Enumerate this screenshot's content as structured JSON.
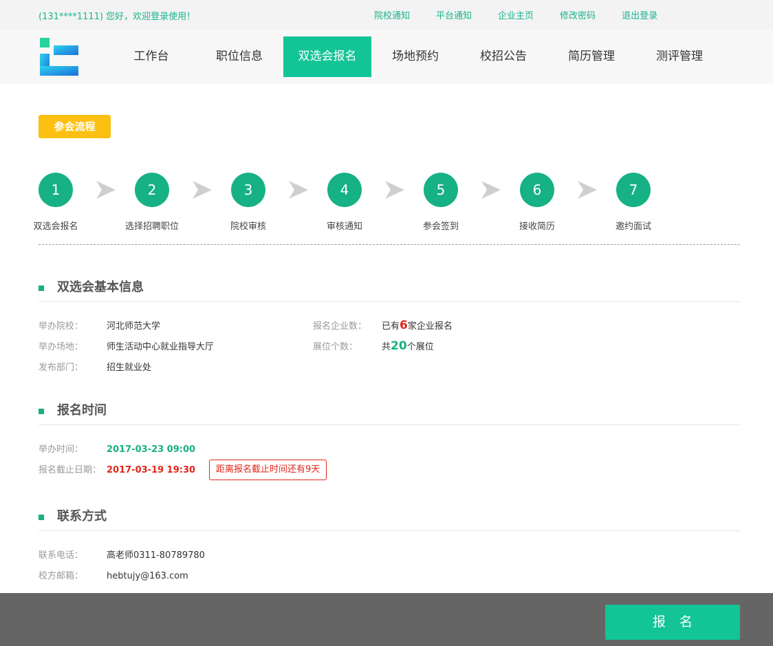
{
  "topbar": {
    "welcome": "(131****1111) 您好，欢迎登录使用！",
    "links": [
      "院校通知",
      "平台通知",
      "企业主页",
      "修改密码",
      "退出登录"
    ]
  },
  "nav": {
    "items": [
      "工作台",
      "职位信息",
      "双选会报名",
      "场地预约",
      "校招公告",
      "简历管理",
      "测评管理"
    ],
    "active_index": 2
  },
  "flow": {
    "badge": "参会流程",
    "steps": [
      {
        "num": "1",
        "label": "双选会报名"
      },
      {
        "num": "2",
        "label": "选择招聘职位"
      },
      {
        "num": "3",
        "label": "院校审核"
      },
      {
        "num": "4",
        "label": "审核通知"
      },
      {
        "num": "5",
        "label": "参会签到"
      },
      {
        "num": "6",
        "label": "接收简历"
      },
      {
        "num": "7",
        "label": "邀约面试"
      }
    ]
  },
  "basic": {
    "title": "双选会基本信息",
    "school_k": "举办院校：",
    "school_v": "河北师范大学",
    "venue_k": "举办场地：",
    "venue_v": "师生活动中心就业指导大厅",
    "dept_k": "发布部门：",
    "dept_v": "招生就业处",
    "companies_k": "报名企业数：",
    "companies_pre": "已有",
    "companies_n": "6",
    "companies_post": "家企业报名",
    "booths_k": "展位个数：",
    "booths_pre": "共",
    "booths_n": "20",
    "booths_post": "个展位"
  },
  "time": {
    "title": "报名时间",
    "hold_k": "举办时间：",
    "hold_v": "2017-03-23 09:00",
    "deadline_k": "报名截止日期：",
    "deadline_v": "2017-03-19 19:30",
    "countdown": "距离报名截止时间还有9天"
  },
  "contact": {
    "title": "联系方式",
    "phone_k": "联系电话：",
    "phone_v": "高老师0311-80789780",
    "email_k": "校方邮箱：",
    "email_v": "hebtujy@163.com"
  },
  "footer": {
    "button": "报名"
  },
  "colors": {
    "accent": "#13c497",
    "badge": "#fbc011",
    "alert": "#e2251a",
    "footer_bg": "#656565"
  }
}
